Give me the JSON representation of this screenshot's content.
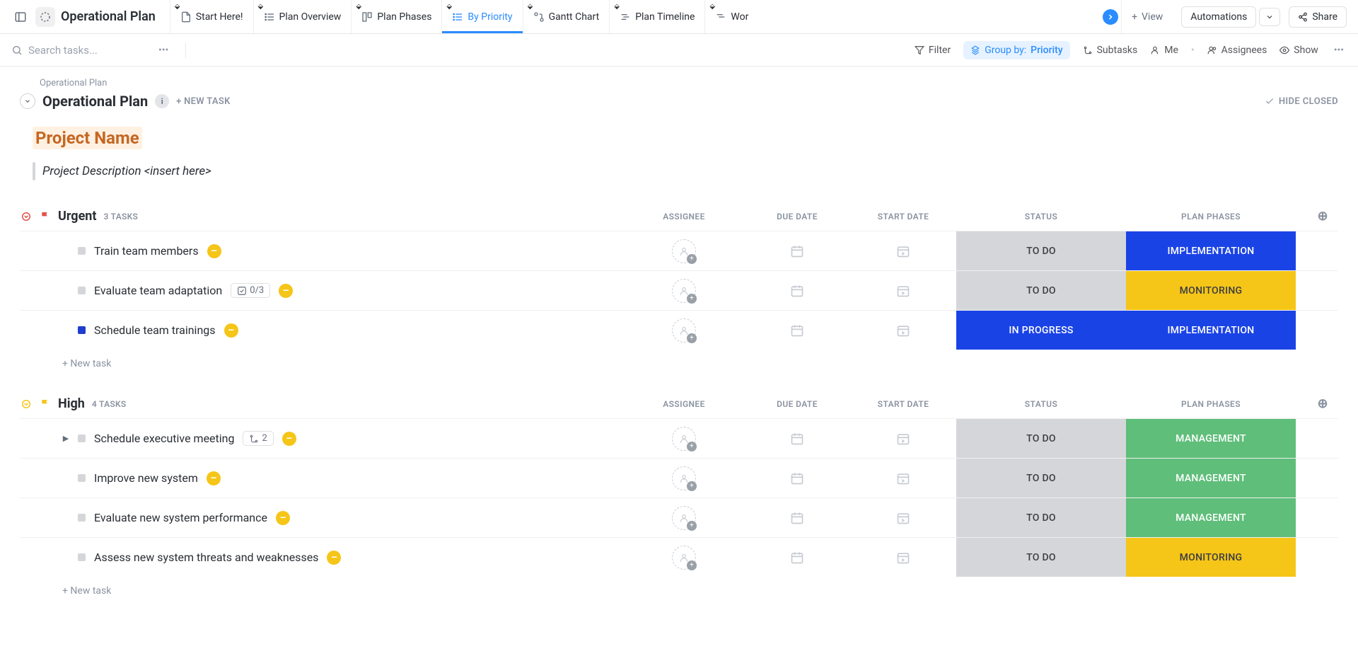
{
  "topbar": {
    "title": "Operational Plan",
    "tabs": [
      {
        "label": "Start Here!",
        "icon": "doc"
      },
      {
        "label": "Plan Overview",
        "icon": "list"
      },
      {
        "label": "Plan Phases",
        "icon": "board"
      },
      {
        "label": "By Priority",
        "icon": "list",
        "active": true
      },
      {
        "label": "Gantt Chart",
        "icon": "gantt"
      },
      {
        "label": "Plan Timeline",
        "icon": "timeline"
      },
      {
        "label": "Wor",
        "icon": "timeline"
      }
    ],
    "add_view": "View",
    "automations": "Automations",
    "share": "Share"
  },
  "filterbar": {
    "search_placeholder": "Search tasks...",
    "filter": "Filter",
    "group_label": "Group by:",
    "group_value": "Priority",
    "subtasks": "Subtasks",
    "me": "Me",
    "assignees": "Assignees",
    "show": "Show"
  },
  "page": {
    "breadcrumb": "Operational Plan",
    "title": "Operational Plan",
    "new_task": "+ NEW TASK",
    "hide_closed": "HIDE CLOSED",
    "doc_title": "Project Name",
    "doc_desc": "Project Description <insert here>"
  },
  "columns": {
    "assignee": "ASSIGNEE",
    "due_date": "DUE DATE",
    "start_date": "START DATE",
    "status": "STATUS",
    "plan_phases": "PLAN PHASES"
  },
  "status_labels": {
    "todo": "TO DO",
    "inprog": "IN PROGRESS"
  },
  "phase_labels": {
    "impl": "IMPLEMENTATION",
    "monitor": "MONITORING",
    "mgmt": "MANAGEMENT"
  },
  "groups": [
    {
      "name": "Urgent",
      "color": "red",
      "count": "3 TASKS",
      "tasks": [
        {
          "name": "Train team members",
          "status": "todo",
          "phase": "impl",
          "dot": "grey"
        },
        {
          "name": "Evaluate team adaptation",
          "status": "todo",
          "phase": "monitor",
          "dot": "grey",
          "checklist": "0/3"
        },
        {
          "name": "Schedule team trainings",
          "status": "inprog",
          "phase": "impl",
          "dot": "blue"
        }
      ],
      "new_task": "+ New task"
    },
    {
      "name": "High",
      "color": "yellow",
      "count": "4 TASKS",
      "tasks": [
        {
          "name": "Schedule executive meeting",
          "status": "todo",
          "phase": "mgmt",
          "dot": "grey",
          "subtasks": "2",
          "expandable": true
        },
        {
          "name": "Improve new system",
          "status": "todo",
          "phase": "mgmt",
          "dot": "grey"
        },
        {
          "name": "Evaluate new system performance",
          "status": "todo",
          "phase": "mgmt",
          "dot": "grey"
        },
        {
          "name": "Assess new system threats and weaknesses",
          "status": "todo",
          "phase": "monitor",
          "dot": "grey"
        }
      ],
      "new_task": "+ New task"
    }
  ]
}
